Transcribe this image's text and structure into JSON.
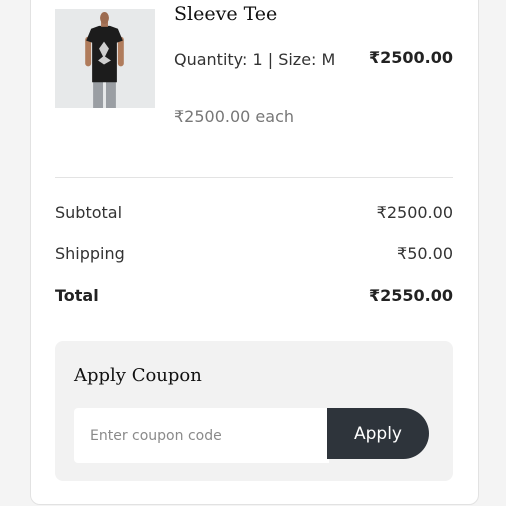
{
  "item": {
    "name": "Sleeve Tee",
    "meta": "Quantity: 1 | Size: M",
    "line_total": "₹2500.00",
    "unit_price": "₹2500.00 each",
    "image_icon": "black-tshirt-model-photo"
  },
  "summary": {
    "subtotal_label": "Subtotal",
    "subtotal_value": "₹2500.00",
    "shipping_label": "Shipping",
    "shipping_value": "₹50.00",
    "total_label": "Total",
    "total_value": "₹2550.00"
  },
  "coupon": {
    "title": "Apply Coupon",
    "placeholder": "Enter coupon code",
    "button_label": "Apply"
  },
  "colors": {
    "button_bg": "#2e343b",
    "coupon_panel_bg": "#f2f2f2",
    "page_bg": "#f4f4f4"
  }
}
